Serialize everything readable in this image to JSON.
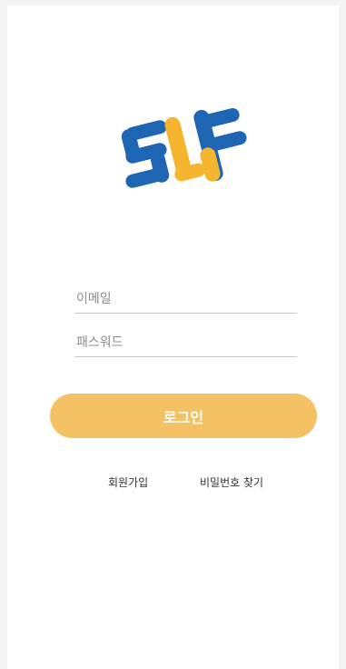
{
  "colors": {
    "background": "#f4f4f4",
    "surface": "#ffffff",
    "logo_blue": "#1e66b4",
    "logo_yellow": "#f5b52e",
    "login_button": "#f4c264",
    "field_underline": "#c9c9c9"
  },
  "logo": {
    "icon": "slf-logo"
  },
  "form": {
    "email_placeholder": "이메일",
    "email_value": "",
    "password_placeholder": "패스워드",
    "password_value": ""
  },
  "login_button_label": "로그인",
  "links": {
    "signup": "회원가입",
    "find_password": "비밀번호 찾기"
  }
}
